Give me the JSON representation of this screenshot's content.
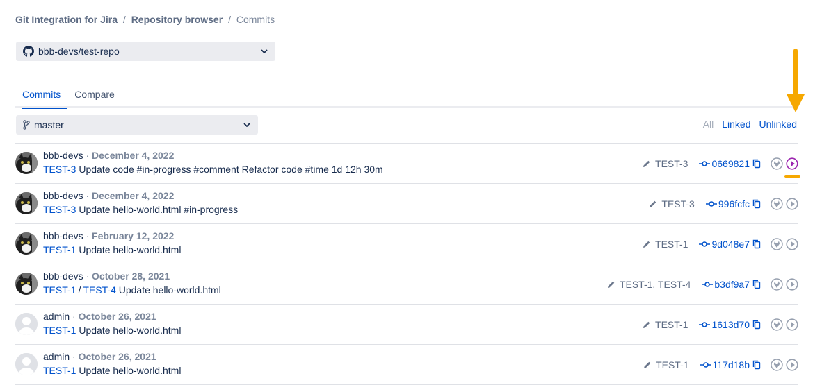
{
  "breadcrumb": {
    "root": "Git Integration for Jira",
    "section": "Repository browser",
    "current": "Commits",
    "sep": "/"
  },
  "repo_select": {
    "value": "bbb-devs/test-repo"
  },
  "tabs": [
    {
      "label": "Commits"
    },
    {
      "label": "Compare"
    }
  ],
  "branch_select": {
    "value": "master"
  },
  "filters": {
    "all": "All",
    "linked": "Linked",
    "unlinked": "Unlinked"
  },
  "commits": [
    {
      "author": "bbb-devs",
      "date": "December 4, 2022",
      "issues": [
        "TEST-3"
      ],
      "message": "Update code #in-progress #comment Refactor code #time 1d 12h 30m",
      "keys": "TEST-3",
      "hash": "0669821",
      "avatar": "cat"
    },
    {
      "author": "bbb-devs",
      "date": "December 4, 2022",
      "issues": [
        "TEST-3"
      ],
      "message": "Update hello-world.html #in-progress",
      "keys": "TEST-3",
      "hash": "996fcfc",
      "avatar": "cat"
    },
    {
      "author": "bbb-devs",
      "date": "February 12, 2022",
      "issues": [
        "TEST-1"
      ],
      "message": "Update hello-world.html",
      "keys": "TEST-1",
      "hash": "9d048e7",
      "avatar": "cat"
    },
    {
      "author": "bbb-devs",
      "date": "October 28, 2021",
      "issues": [
        "TEST-1",
        "TEST-4"
      ],
      "message": "Update hello-world.html",
      "keys": "TEST-1, TEST-4",
      "hash": "b3df9a7",
      "avatar": "cat"
    },
    {
      "author": "admin",
      "date": "October 26, 2021",
      "issues": [
        "TEST-1"
      ],
      "message": "Update hello-world.html",
      "keys": "TEST-1",
      "hash": "1613d70",
      "avatar": "default"
    },
    {
      "author": "admin",
      "date": "October 26, 2021",
      "issues": [
        "TEST-1"
      ],
      "message": "Update hello-world.html",
      "keys": "TEST-1",
      "hash": "117d18b",
      "avatar": "default"
    }
  ],
  "icons": {
    "repo": "github-icon",
    "dropdown": "chevron-down-icon",
    "branch": "branch-icon",
    "pencil": "pencil-icon",
    "commit": "commit-icon",
    "copy": "copy-icon",
    "view": "gitlab-icon",
    "time": "time-tracking-icon"
  },
  "colors": {
    "link": "#0052cc",
    "highlight": "#f6a800",
    "active_time_icon": "#9c27b0",
    "muted": "#7a869a"
  }
}
